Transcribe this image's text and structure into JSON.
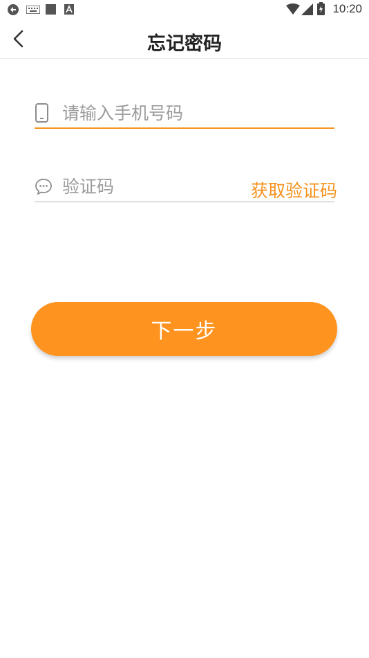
{
  "status_bar": {
    "time": "10:20",
    "left_icons": [
      "sync-icon",
      "keyboard-icon",
      "square-notification-icon",
      "a-notification-icon"
    ],
    "right_icons": [
      "wifi-icon",
      "signal-icon",
      "battery-icon"
    ]
  },
  "header": {
    "title": "忘记密码",
    "back_icon": "chevron-left-icon"
  },
  "form": {
    "phone": {
      "placeholder": "请输入手机号码",
      "value": "",
      "icon": "phone-icon"
    },
    "code": {
      "placeholder": "验证码",
      "value": "",
      "icon": "chat-bubble-icon",
      "get_code_label": "获取验证码"
    }
  },
  "next_button": {
    "label": "下一步"
  },
  "colors": {
    "accent": "#fe931f",
    "text": "#222222",
    "placeholder": "#9b9b9b"
  }
}
